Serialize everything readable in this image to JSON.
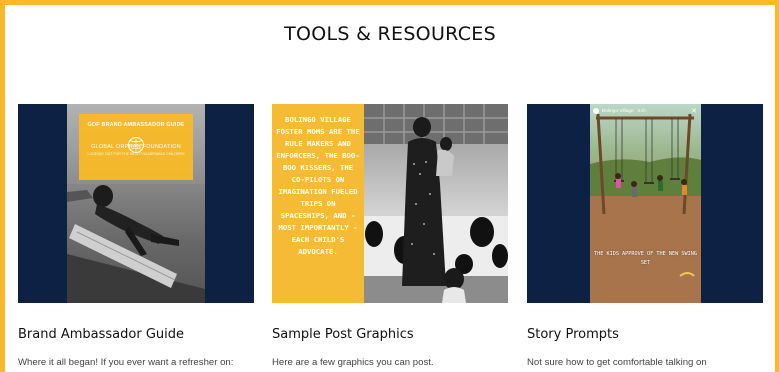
{
  "page": {
    "title": "TOOLS & RESOURCES"
  },
  "cards": [
    {
      "title": "Brand Ambassador Guide",
      "description": "Where it all began! If you ever want a refresher on:",
      "thumbnail": {
        "banner_title": "GOF BRAND AMBASSADOR GUIDE",
        "banner_org": "GLOBAL ORPHAN FOUNDATION",
        "banner_tagline": "LOOKING OUT FOR THE MOST VULNERABLE CHILDREN"
      }
    },
    {
      "title": "Sample Post Graphics",
      "description": "Here are a few graphics you can post.",
      "thumbnail": {
        "quote": "Bolingo Village foster moms are the rule makers and enforcers, the boo-boo kissers, the co-pilots on imagination fueled trips on spaceships, and - most importantly - each child's advocate."
      }
    },
    {
      "title": "Story Prompts",
      "description": "Not sure how to get comfortable talking on",
      "thumbnail": {
        "story_account": "Bolingo Village",
        "story_time": "23h",
        "caption": "THE KIDS APPROVE OF THE NEW SWING SET"
      }
    }
  ],
  "colors": {
    "frame": "#fbb927",
    "navy": "#0d2145",
    "accent_yellow": "#f9b927"
  }
}
